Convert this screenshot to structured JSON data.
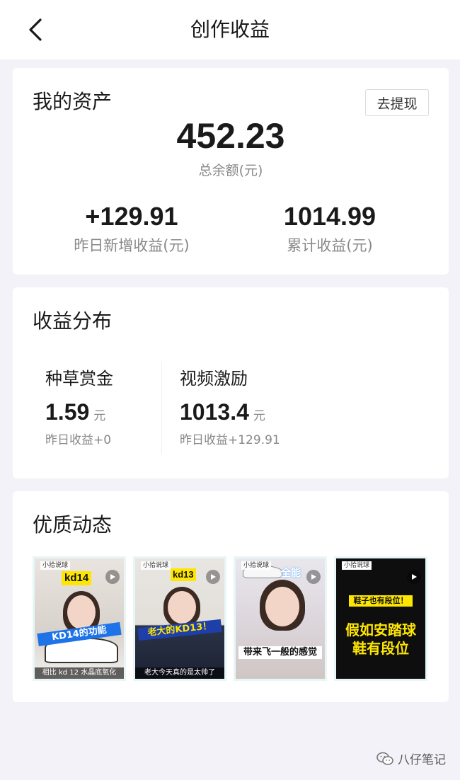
{
  "header": {
    "title": "创作收益"
  },
  "assets": {
    "title": "我的资产",
    "withdraw_label": "去提现",
    "total_balance": "452.23",
    "total_balance_caption": "总余额(元)",
    "yesterday_new": "+129.91",
    "yesterday_new_label": "昨日新增收益(元)",
    "cumulative": "1014.99",
    "cumulative_label": "累计收益(元)"
  },
  "distribution": {
    "title": "收益分布",
    "items": [
      {
        "name": "种草赏金",
        "amount": "1.59",
        "unit": "元",
        "yesterday": "昨日收益+0"
      },
      {
        "name": "视频激励",
        "amount": "1013.4",
        "unit": "元",
        "yesterday": "昨日收益+129.91"
      }
    ]
  },
  "posts": {
    "title": "优质动态",
    "thumbnails": [
      {
        "tag": "小拾说球",
        "top_text": "kd14",
        "mid_text": "KD14的功能",
        "subtitle": "相比 kd 12 水晶底氧化",
        "icon": "play-icon"
      },
      {
        "tag": "小拾说球",
        "top_text": "kd13",
        "mid_text": "老大的KD13！",
        "subtitle": "老大今天真的是太帅了",
        "icon": "play-icon"
      },
      {
        "tag": "小拾说球",
        "top_text": "全能",
        "mid_text": "带来飞一般的感觉",
        "subtitle": "",
        "icon": "play-icon"
      },
      {
        "tag": "小拾说球",
        "top_text": "鞋子也有段位！",
        "mid_text": "假如安踏球鞋有段位",
        "subtitle": "",
        "icon": "play-icon"
      }
    ]
  },
  "watermark": {
    "text": "八仔笔记",
    "icon": "wechat-icon"
  },
  "colors": {
    "background": "#f2f2f8",
    "card": "#ffffff",
    "text_primary": "#1a1a1a",
    "text_secondary": "#888888",
    "thumb_border": "#e8f6f7",
    "highlight_yellow": "#ffe600"
  }
}
